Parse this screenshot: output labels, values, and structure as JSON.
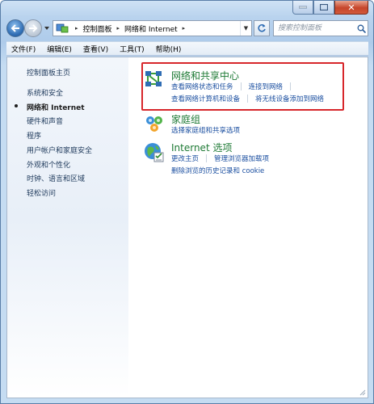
{
  "window": {
    "close_glyph": "✕"
  },
  "address": {
    "crumbs": [
      "控制面板",
      "网络和 Internet"
    ],
    "search_placeholder": "搜索控制面板"
  },
  "menu": {
    "items": [
      "文件(F)",
      "编辑(E)",
      "查看(V)",
      "工具(T)",
      "帮助(H)"
    ]
  },
  "sidebar": {
    "items": [
      {
        "label": "控制面板主页",
        "current": false
      },
      {
        "label": "系统和安全",
        "current": false
      },
      {
        "label": "网络和 Internet",
        "current": true
      },
      {
        "label": "硬件和声音",
        "current": false
      },
      {
        "label": "程序",
        "current": false
      },
      {
        "label": "用户帐户和家庭安全",
        "current": false
      },
      {
        "label": "外观和个性化",
        "current": false
      },
      {
        "label": "时钟、语言和区域",
        "current": false
      },
      {
        "label": "轻松访问",
        "current": false
      }
    ]
  },
  "categories": [
    {
      "title": "网络和共享中心",
      "icon": "network-sharing-center-icon",
      "highlighted": true,
      "links": [
        [
          "查看网络状态和任务",
          "连接到网络"
        ],
        [
          "查看网络计算机和设备",
          "将无线设备添加到网络"
        ]
      ]
    },
    {
      "title": "家庭组",
      "icon": "homegroup-icon",
      "highlighted": false,
      "links": [
        [
          "选择家庭组和共享选项"
        ]
      ]
    },
    {
      "title": "Internet 选项",
      "icon": "internet-options-icon",
      "highlighted": false,
      "links": [
        [
          "更改主页",
          "管理浏览器加载项"
        ],
        [
          "删除浏览的历史记录和 cookie"
        ]
      ]
    }
  ],
  "colors": {
    "category_title": "#1e7a35",
    "link": "#1b4fa0",
    "highlight_border": "#d7262b"
  }
}
